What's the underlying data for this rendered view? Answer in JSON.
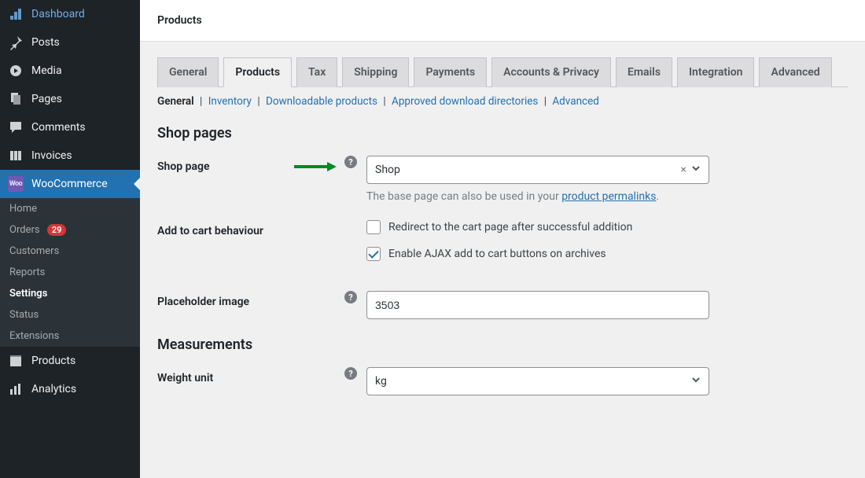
{
  "sidebar": {
    "items": [
      {
        "label": "Dashboard"
      },
      {
        "label": "Posts"
      },
      {
        "label": "Media"
      },
      {
        "label": "Pages"
      },
      {
        "label": "Comments"
      },
      {
        "label": "Invoices"
      },
      {
        "label": "WooCommerce"
      },
      {
        "label": "Products"
      },
      {
        "label": "Analytics"
      }
    ],
    "sub": [
      {
        "label": "Home"
      },
      {
        "label": "Orders",
        "badge": "29"
      },
      {
        "label": "Customers"
      },
      {
        "label": "Reports"
      },
      {
        "label": "Settings"
      },
      {
        "label": "Status"
      },
      {
        "label": "Extensions"
      }
    ]
  },
  "topbar": {
    "title": "Products"
  },
  "tabs": [
    {
      "label": "General"
    },
    {
      "label": "Products"
    },
    {
      "label": "Tax"
    },
    {
      "label": "Shipping"
    },
    {
      "label": "Payments"
    },
    {
      "label": "Accounts & Privacy"
    },
    {
      "label": "Emails"
    },
    {
      "label": "Integration"
    },
    {
      "label": "Advanced"
    }
  ],
  "subtabs": [
    {
      "label": "General"
    },
    {
      "label": "Inventory"
    },
    {
      "label": "Downloadable products"
    },
    {
      "label": "Approved download directories"
    },
    {
      "label": "Advanced"
    }
  ],
  "sections": {
    "shop_pages": "Shop pages",
    "measurements": "Measurements"
  },
  "fields": {
    "shop_page": {
      "label": "Shop page",
      "value": "Shop",
      "clear": "×",
      "hint_pre": "The base page can also be used in your ",
      "hint_link": "product permalinks",
      "hint_post": "."
    },
    "add_to_cart": {
      "label": "Add to cart behaviour",
      "opt1": "Redirect to the cart page after successful addition",
      "opt2": "Enable AJAX add to cart buttons on archives"
    },
    "placeholder_image": {
      "label": "Placeholder image",
      "value": "3503"
    },
    "weight_unit": {
      "label": "Weight unit",
      "value": "kg"
    }
  }
}
